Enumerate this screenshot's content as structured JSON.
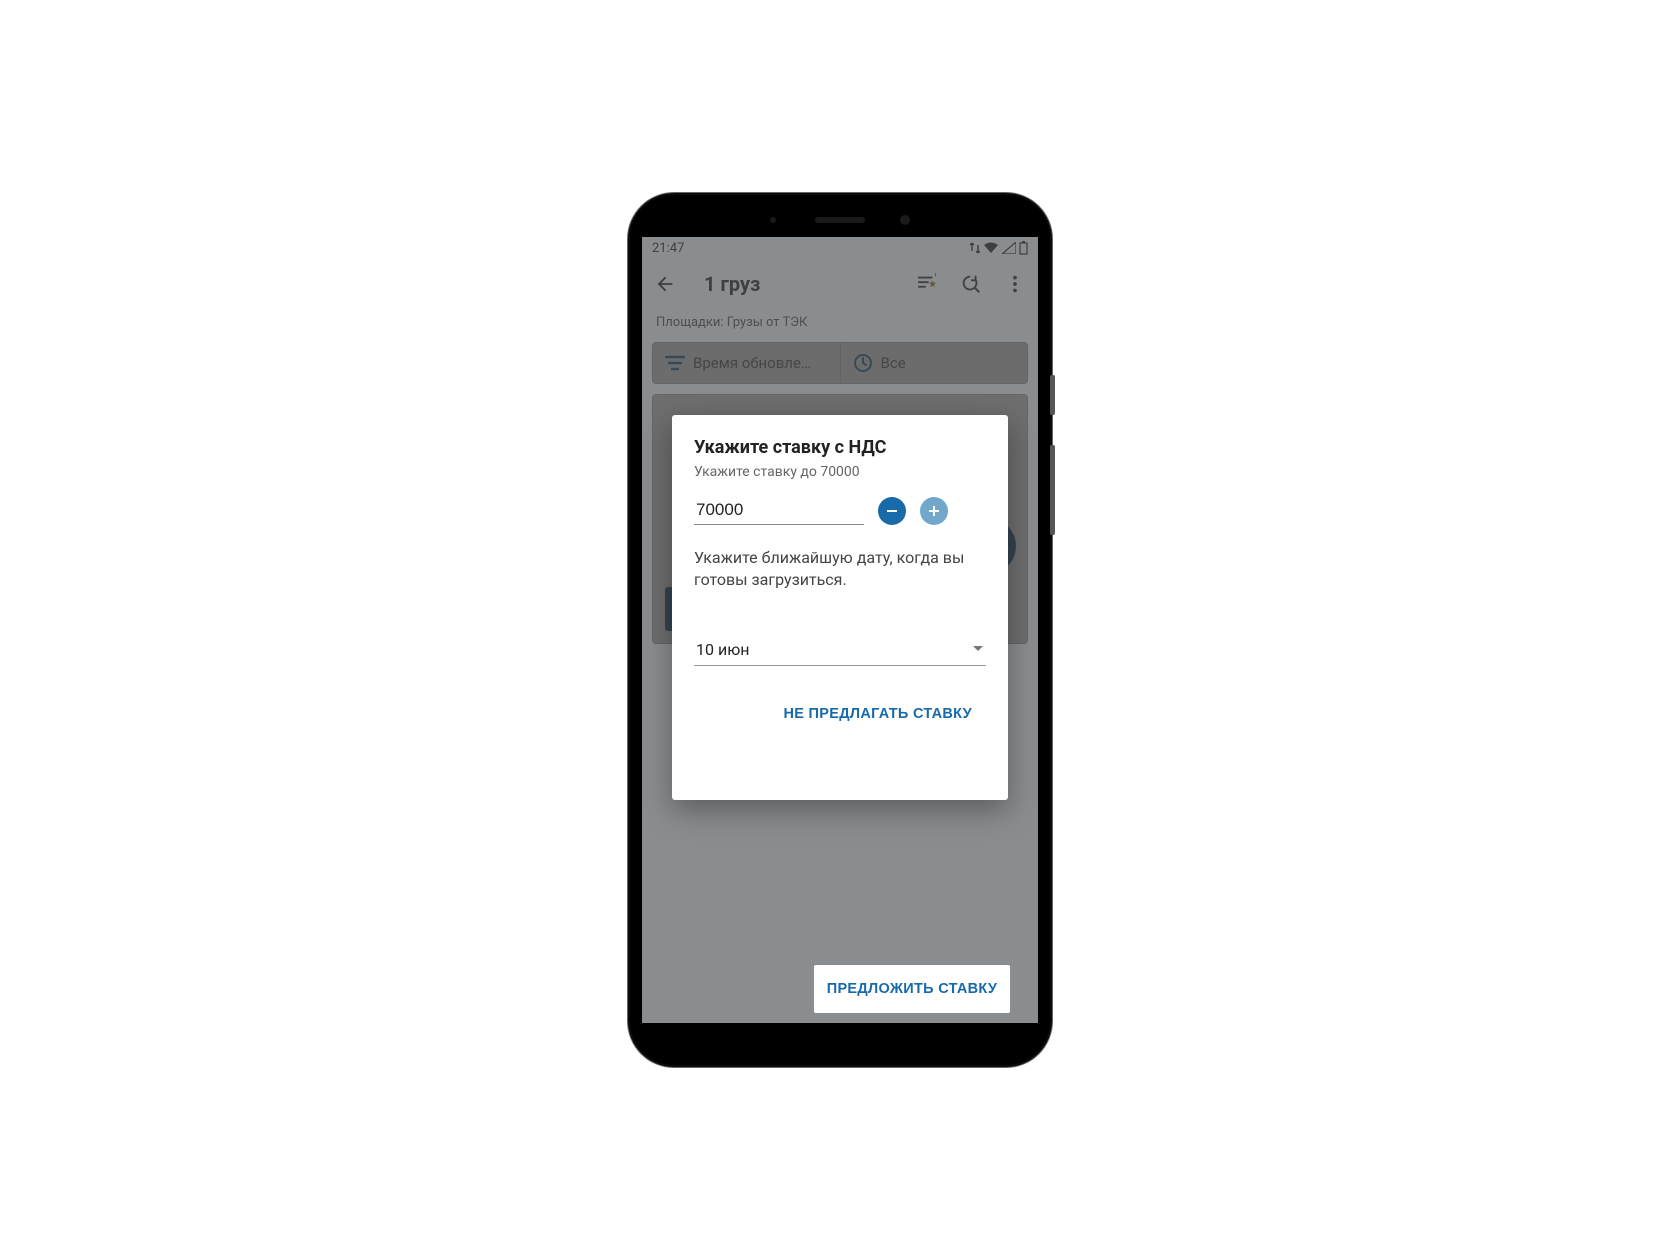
{
  "status": {
    "time": "21:47"
  },
  "toolbar": {
    "title": "1 груз",
    "chip": "Площадки: Грузы от ТЭК"
  },
  "filters": {
    "sort": "Время обновле…",
    "time": "Все"
  },
  "dialog": {
    "title": "Укажите ставку с НДС",
    "subtitle": "Укажите ставку до 70000",
    "rate_value": "70000",
    "date_prompt": "Укажите ближайшую дату, когда вы готовы загрузиться.",
    "date_value": "10 июн",
    "action_skip": "НЕ ПРЕДЛАГАТЬ СТАВКУ",
    "action_submit": "ПРЕДЛОЖИТЬ СТАВКУ"
  }
}
